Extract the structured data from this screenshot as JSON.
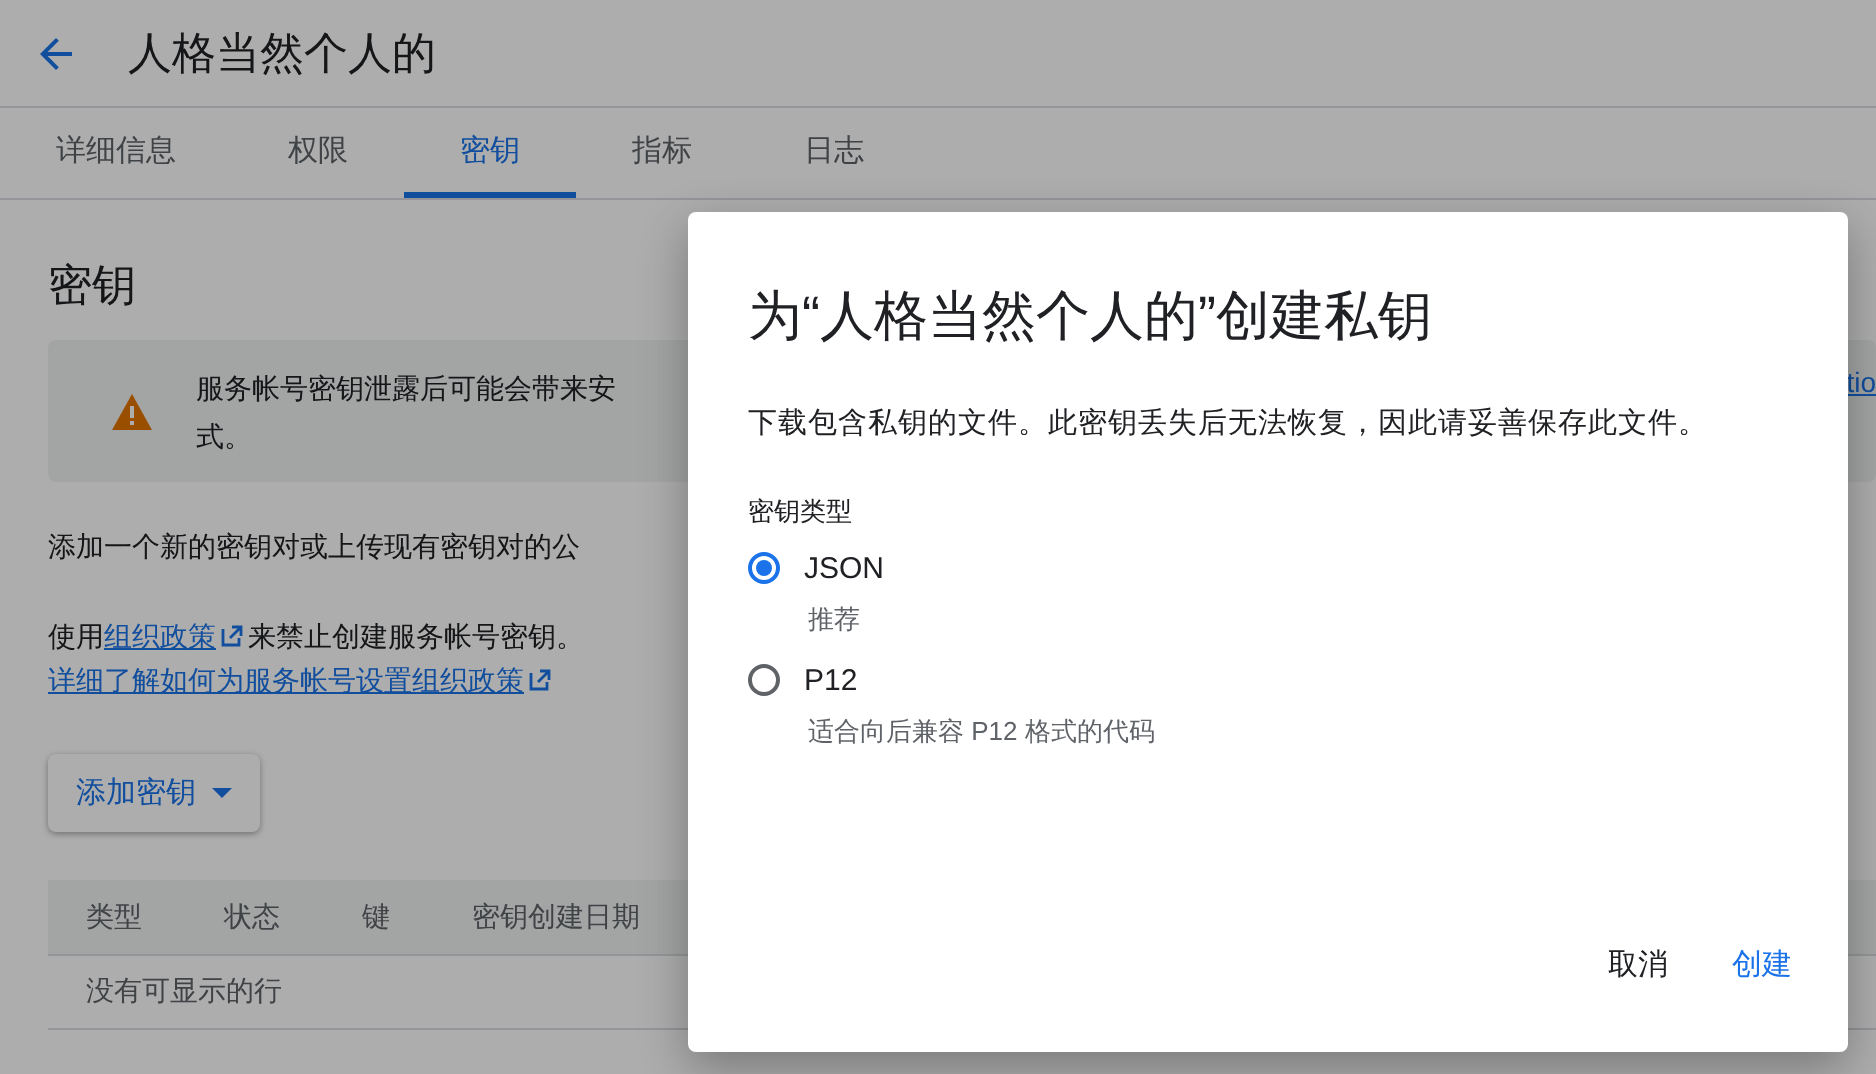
{
  "header": {
    "title": "人格当然个人的"
  },
  "tabs": [
    {
      "label": "详细信息",
      "selected": false
    },
    {
      "label": "权限",
      "selected": false
    },
    {
      "label": "密钥",
      "selected": true
    },
    {
      "label": "指标",
      "selected": false
    },
    {
      "label": "日志",
      "selected": false
    }
  ],
  "section": {
    "title": "密钥",
    "banner": {
      "lines": [
        "服务帐号密钥泄露后可能会带来安",
        "式。"
      ],
      "link": "tio"
    },
    "intro": "添加一个新的密钥对或上传现有密钥对的公",
    "policy": {
      "prefix": "使用",
      "link": "组织政策",
      "suffix": "来禁止创建服务帐号密钥。"
    },
    "learn_more": "详细了解如何为服务帐号设置组织政策",
    "add_button": "添加密钥",
    "table": {
      "columns": [
        "类型",
        "状态",
        "键",
        "密钥创建日期"
      ],
      "empty": "没有可显示的行"
    }
  },
  "dialog": {
    "title": "为“人格当然个人的”创建私钥",
    "description": "下载包含私钥的文件。此密钥丢失后无法恢复，因此请妥善保存此文件。",
    "field_label": "密钥类型",
    "options": [
      {
        "label": "JSON",
        "hint": "推荐",
        "selected": true
      },
      {
        "label": "P12",
        "hint": "适合向后兼容 P12 格式的代码",
        "selected": false
      }
    ],
    "buttons": [
      {
        "label": "取消",
        "kind": "secondary"
      },
      {
        "label": "创建",
        "kind": "primary"
      }
    ]
  }
}
